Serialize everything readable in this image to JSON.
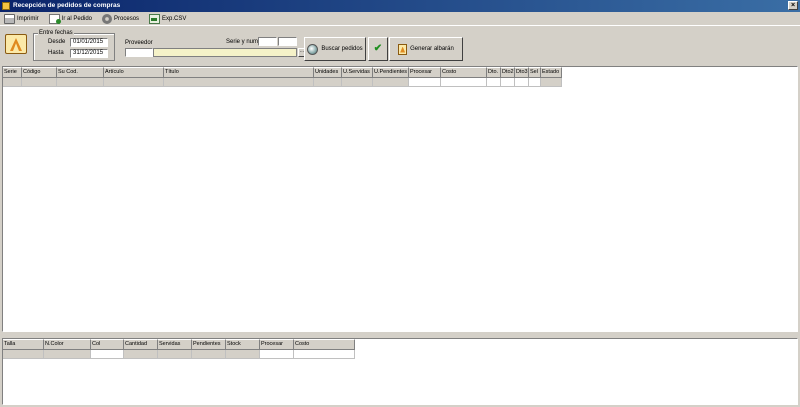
{
  "window": {
    "title": "Recepción de pedidos de compras"
  },
  "menu": [
    {
      "label": "Imprimir",
      "icon": "printer-icon"
    },
    {
      "label": "Ir al Pedido",
      "icon": "document-go-icon"
    },
    {
      "label": "Procesos",
      "icon": "gears-icon"
    },
    {
      "label": "Exp.CSV",
      "icon": "csv-export-icon"
    }
  ],
  "filters": {
    "group_title": "Entre fechas",
    "desde_label": "Desde",
    "desde_value": "01/01/2015",
    "hasta_label": "Hasta",
    "hasta_value": "31/12/2015",
    "proveedor_label": "Proveedor",
    "proveedor_value": "",
    "serie_label": "Serie y num.",
    "serie_value": "",
    "num_value": ""
  },
  "buttons": {
    "search_label": "Buscar pedidos",
    "generate_label": "Generar albarán"
  },
  "upper_grid": {
    "columns": [
      "Serie",
      "Código",
      "Su Cod.",
      "Artículo",
      "Título",
      "Unidades",
      "U.Servidas",
      "U.Pendientes",
      "Procesar",
      "Costo",
      "Dto.",
      "Dto2",
      "Dto3",
      "Sel",
      "Estado"
    ]
  },
  "lower_grid": {
    "columns": [
      "Talla",
      "N.Color",
      "Col",
      "Cantidad",
      "Servidas",
      "Pendientes",
      "Stock",
      "Procesar",
      "Costo"
    ]
  },
  "colors": {
    "title_start": "#0a246a",
    "title_end": "#3a6ea5",
    "face": "#d4d0c8",
    "provider_bar": "#f5f2c8"
  }
}
